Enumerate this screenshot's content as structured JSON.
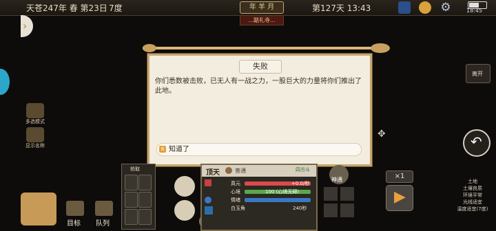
{
  "status_bar": {
    "date": "天苍247年 春 第23日",
    "temperature": "7度",
    "year_badge": "年 羊 月",
    "sub_badge": "...踮礼寺...",
    "day_time": "第127天 13:43",
    "clock": "18:45"
  },
  "left_side": {
    "item1_label": "多选模式",
    "item2_label": "显示名称"
  },
  "dialog": {
    "title": "失败",
    "body": "你们悉数被击败，已无人有一战之力，一股巨大的力量将你们推出了此地。",
    "option_badge": "8",
    "option_label": "知道了"
  },
  "bottom_left": {
    "target_label": "目标",
    "team_label": "队列",
    "grab_label": "抢取"
  },
  "character_panel": {
    "name": "顶天",
    "status": "普通",
    "tag": "四方斗",
    "stats": [
      {
        "label": "真元",
        "value": "+0.0/秒"
      },
      {
        "label": "心境",
        "value": "100 (心境无碍)"
      },
      {
        "label": "情绪",
        "value": ""
      },
      {
        "label": "白玉角",
        "value": "240秒"
      }
    ]
  },
  "right_side": {
    "leave_label": "离开",
    "speed": "×1",
    "skill_label": "神通",
    "info_lines": [
      "土地",
      "土壤良质",
      "环境平常",
      "光线适宜",
      "温度适宜(7度)"
    ]
  },
  "colors": {
    "accent": "#c8a56e",
    "dialog_bg": "#f3ede0",
    "hp_bar": "#d94a4a",
    "mood_bar": "#5aa84a",
    "mana_bar": "#3a78c2"
  }
}
